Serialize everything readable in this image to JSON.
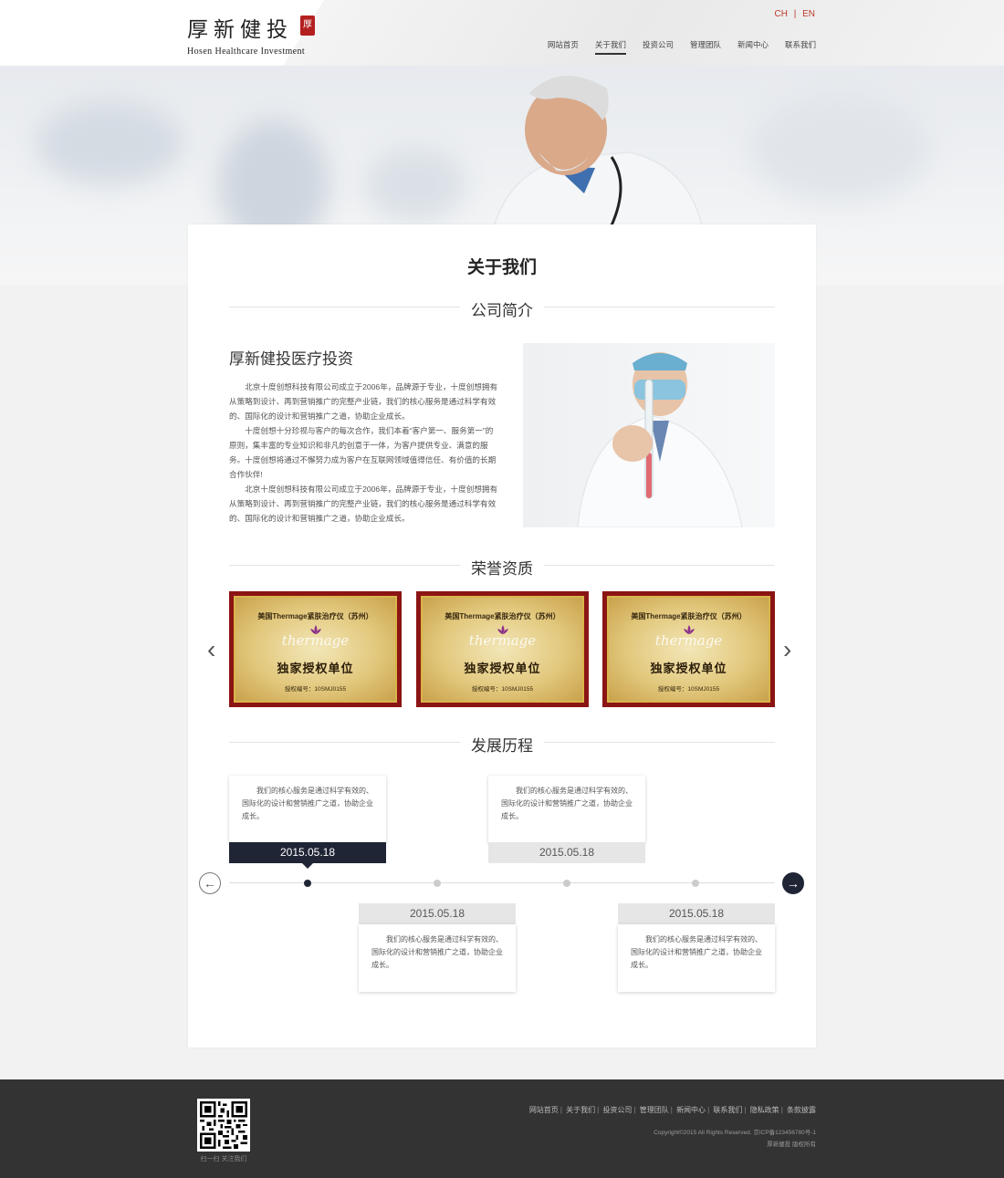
{
  "header": {
    "logo_cn": "厚新健投",
    "logo_seal": "厚",
    "logo_en": "Hosen Healthcare Investment",
    "lang_ch": "CH",
    "lang_sep": "|",
    "lang_en": "EN",
    "nav": [
      "网站首页",
      "关于我们",
      "投资公司",
      "管理团队",
      "新闻中心",
      "联系我们"
    ],
    "active_nav": "关于我们"
  },
  "main": {
    "page_title": "关于我们",
    "intro": {
      "section_title": "公司简介",
      "title": "厚新健投医疗投资",
      "paragraphs": [
        "北京十度创想科技有限公司成立于2006年，品牌源于专业，十度创想拥有从策略到设计、再到营销推广的完整产业链，我们的核心服务是通过科学有效的、国际化的设计和营销推广之道，协助企业成长。",
        "十度创想十分珍视与客户的每次合作，我们本着“客户第一、服务第一”的原则，集丰富的专业知识和非凡的创意于一体，为客户提供专业、满意的服务。十度创想将通过不懈努力成为客户在互联网领域值得信任、有价值的长期合作伙伴!",
        "北京十度创想科技有限公司成立于2006年，品牌源于专业，十度创想拥有从策略到设计、再到营销推广的完整产业链，我们的核心服务是通过科学有效的、国际化的设计和营销推广之道，协助企业成长。"
      ]
    },
    "honors": {
      "section_title": "荣誉资质",
      "prev_arrow": "‹",
      "next_arrow": "›",
      "certificates": [
        {
          "top": "美国Thermage紧肤治疗仪（苏州）",
          "logo": "thermage",
          "main": "独家授权单位",
          "sub": "授权编号：10SMJ0155"
        },
        {
          "top": "美国Thermage紧肤治疗仪（苏州）",
          "logo": "thermage",
          "main": "独家授权单位",
          "sub": "授权编号：10SMJ0155"
        },
        {
          "top": "美国Thermage紧肤治疗仪（苏州）",
          "logo": "thermage",
          "main": "独家授权单位",
          "sub": "授权编号：10SMJ0155"
        }
      ]
    },
    "history": {
      "section_title": "发展历程",
      "prev": "←",
      "next": "→",
      "events": [
        {
          "date": "2015.05.18",
          "text": "我们的核心服务是通过科学有效的、国际化的设计和营销推广之道，协助企业成长。"
        },
        {
          "date": "2015.05.18",
          "text": "我们的核心服务是通过科学有效的、国际化的设计和营销推广之道，协助企业成长。"
        },
        {
          "date": "2015.05.18",
          "text": "我们的核心服务是通过科学有效的、国际化的设计和营销推广之道，协助企业成长。"
        },
        {
          "date": "2015.05.18",
          "text": "我们的核心服务是通过科学有效的、国际化的设计和营销推广之道，协助企业成长。"
        }
      ]
    }
  },
  "footer": {
    "qr_label": "扫一扫 关注我们",
    "nav": [
      "网站首页",
      "关于我们",
      "投资公司",
      "管理团队",
      "新闻中心",
      "联系我们",
      "隐私政策",
      "条款披露"
    ],
    "copyright": "Copyright©2015 All Rights Reserved. 京ICP备123456780号-1",
    "rights": "厚新健投 版权所有"
  },
  "colors": {
    "accent_red": "#c0392b",
    "timeline_dark": "#1f2535",
    "footer_bg": "#333333"
  }
}
